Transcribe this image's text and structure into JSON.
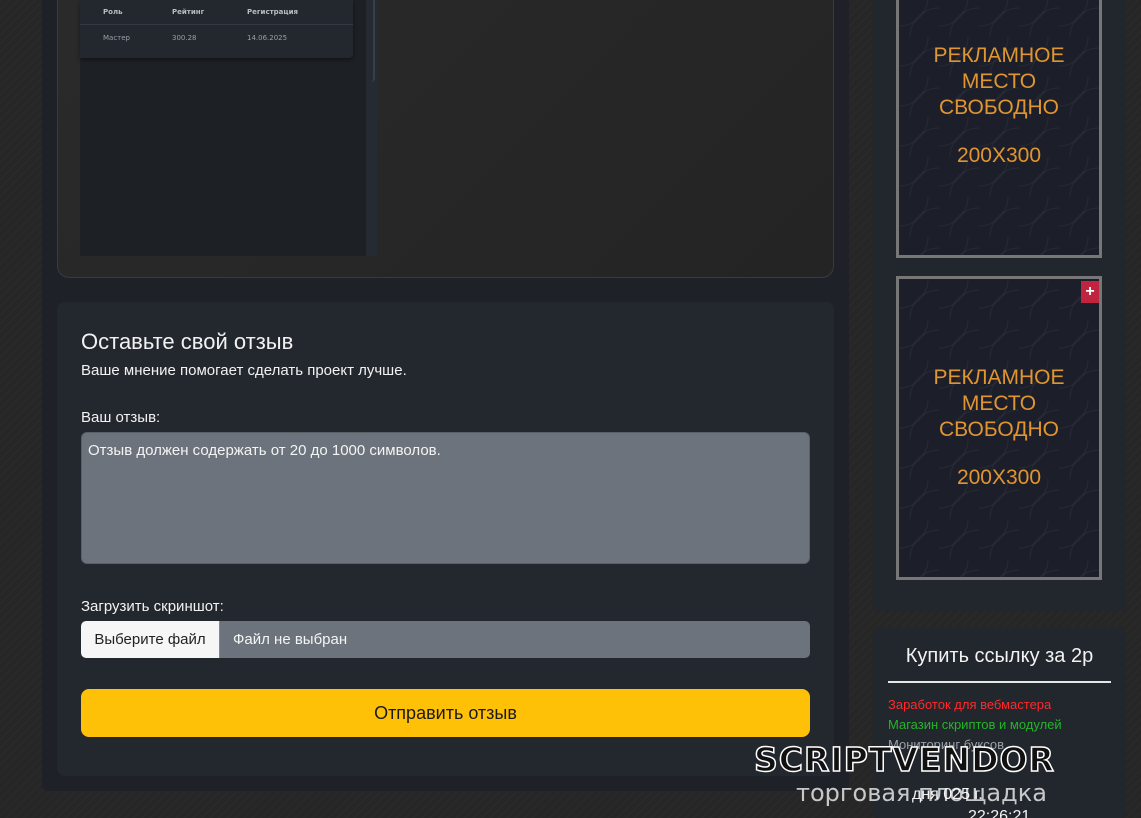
{
  "screenshot_preview": {
    "headers": [
      "Роль",
      "Рейтинг",
      "Регистрация"
    ],
    "row": [
      "Мастер",
      "300.28",
      "14.06.2025"
    ]
  },
  "review": {
    "title": "Оставьте свой отзыв",
    "subtitle": "Ваше мнение помогает сделать проект лучше.",
    "textarea_label": "Ваш отзыв:",
    "textarea_placeholder": "Отзыв должен содержать от 20 до 1000 символов.",
    "upload_label": "Загрузить скриншот:",
    "file_button": "Выберите файл",
    "file_status": "Файл не выбран",
    "submit": "Отправить отзыв"
  },
  "ads": [
    {
      "line1": "РЕКЛАМНОЕ",
      "line2": "МЕСТО",
      "line3": "СВОБОДНО",
      "size": "200X300"
    },
    {
      "line1": "РЕКЛАМНОЕ",
      "line2": "МЕСТО",
      "line3": "СВОБОДНО",
      "size": "200X300",
      "plus": "+"
    }
  ],
  "links": {
    "title": "Купить ссылку за 2р",
    "items": [
      {
        "text": "Заработок для вебмастера",
        "color": "#ff2a2a"
      },
      {
        "text": "Магазин скриптов и модулей",
        "color": "#22b52a"
      },
      {
        "text": "Мониторинг буксов",
        "color": "#9aa0a8"
      }
    ]
  },
  "clock": {
    "date": "дня 025 г.",
    "time": "22:26:21"
  },
  "watermark": {
    "brand": "SCRIPTVENDOR",
    "sub": "торговая площадка"
  }
}
